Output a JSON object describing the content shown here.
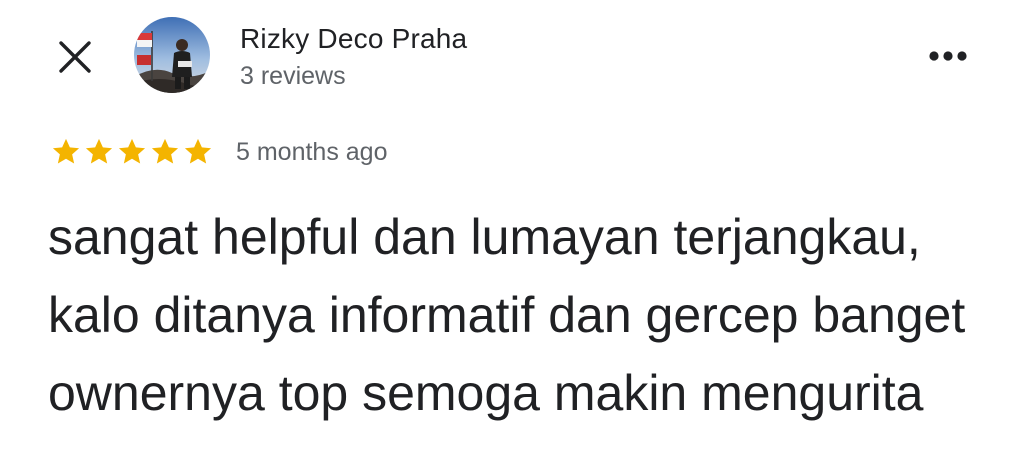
{
  "header": {
    "close_icon": "close-icon",
    "more_icon": "more-horizontal-icon"
  },
  "reviewer": {
    "name": "Rizky Deco Praha",
    "reviews_count": "3 reviews",
    "avatar": "profile-photo"
  },
  "review": {
    "rating": 5,
    "rating_max": 5,
    "time_ago": "5 months ago",
    "text": "sangat helpful dan lumayan terjangkau, kalo ditanya informatif dan gercep banget ownernya top semoga makin mengurita"
  },
  "colors": {
    "star": "#f4b400",
    "primary_text": "#202124",
    "secondary_text": "#5f6368"
  }
}
